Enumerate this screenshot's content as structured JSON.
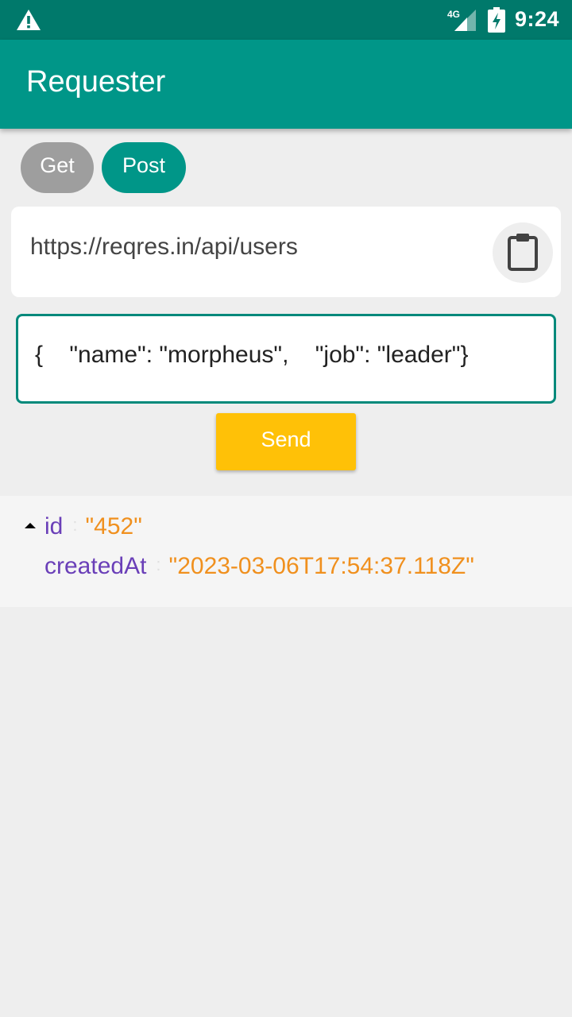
{
  "status_bar": {
    "time": "9:24",
    "network": "4G",
    "icons": [
      "warning-icon",
      "signal-4g-icon",
      "battery-charging-icon"
    ]
  },
  "app_bar": {
    "title": "Requester"
  },
  "method_chips": {
    "get_label": "Get",
    "post_label": "Post",
    "selected": "Post"
  },
  "url": {
    "value": "https://reqres.in/api/users",
    "paste_icon": "clipboard-icon"
  },
  "body": {
    "value": "{    \"name\": \"morpheus\",    \"job\": \"leader\"}"
  },
  "send": {
    "label": "Send"
  },
  "result": {
    "expanded": true,
    "entries": [
      {
        "key": "id",
        "colon": ":",
        "value": "\"452\""
      },
      {
        "key": "createdAt",
        "colon": ":",
        "value": "\"2023-03-06T17:54:37.118Z\""
      }
    ]
  },
  "colors": {
    "primary": "#009688",
    "primary_dark": "#00796b",
    "accent": "#ffc107",
    "key_color": "#6a3fb8",
    "value_color": "#f0901e",
    "chip_inactive": "#9e9e9e"
  }
}
